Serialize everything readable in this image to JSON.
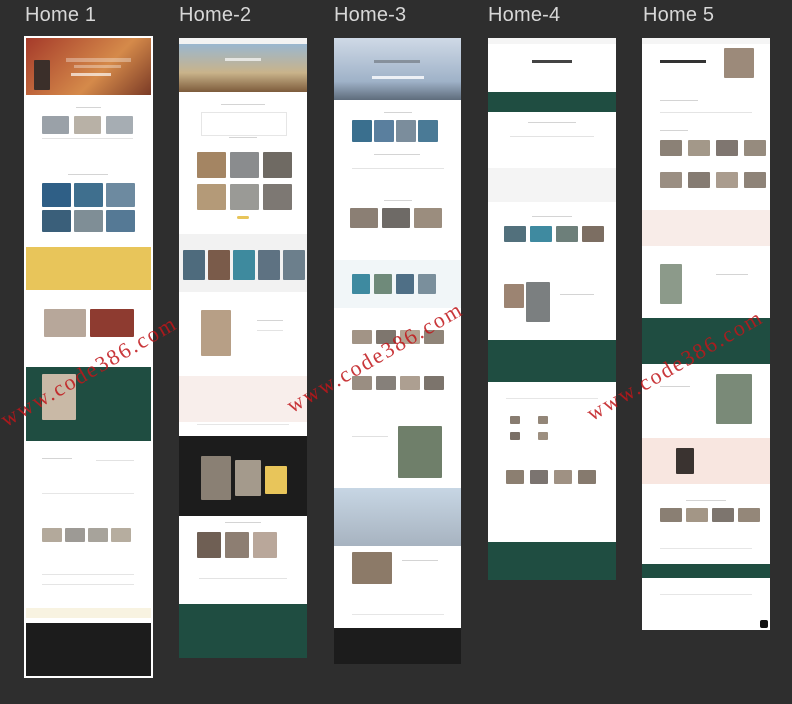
{
  "canvas": {
    "background": "#2e2e2e"
  },
  "frames": [
    {
      "label": "Home 1"
    },
    {
      "label": "Home-2"
    },
    {
      "label": "Home-3"
    },
    {
      "label": "Home-4"
    },
    {
      "label": "Home 5"
    }
  ],
  "watermark": {
    "text": "www.code386.com"
  },
  "colors": {
    "accent_green": "#1f4d41",
    "accent_yellow": "#e8c55a",
    "dark": "#1c1c1c",
    "blush": "#f7e7e3"
  }
}
